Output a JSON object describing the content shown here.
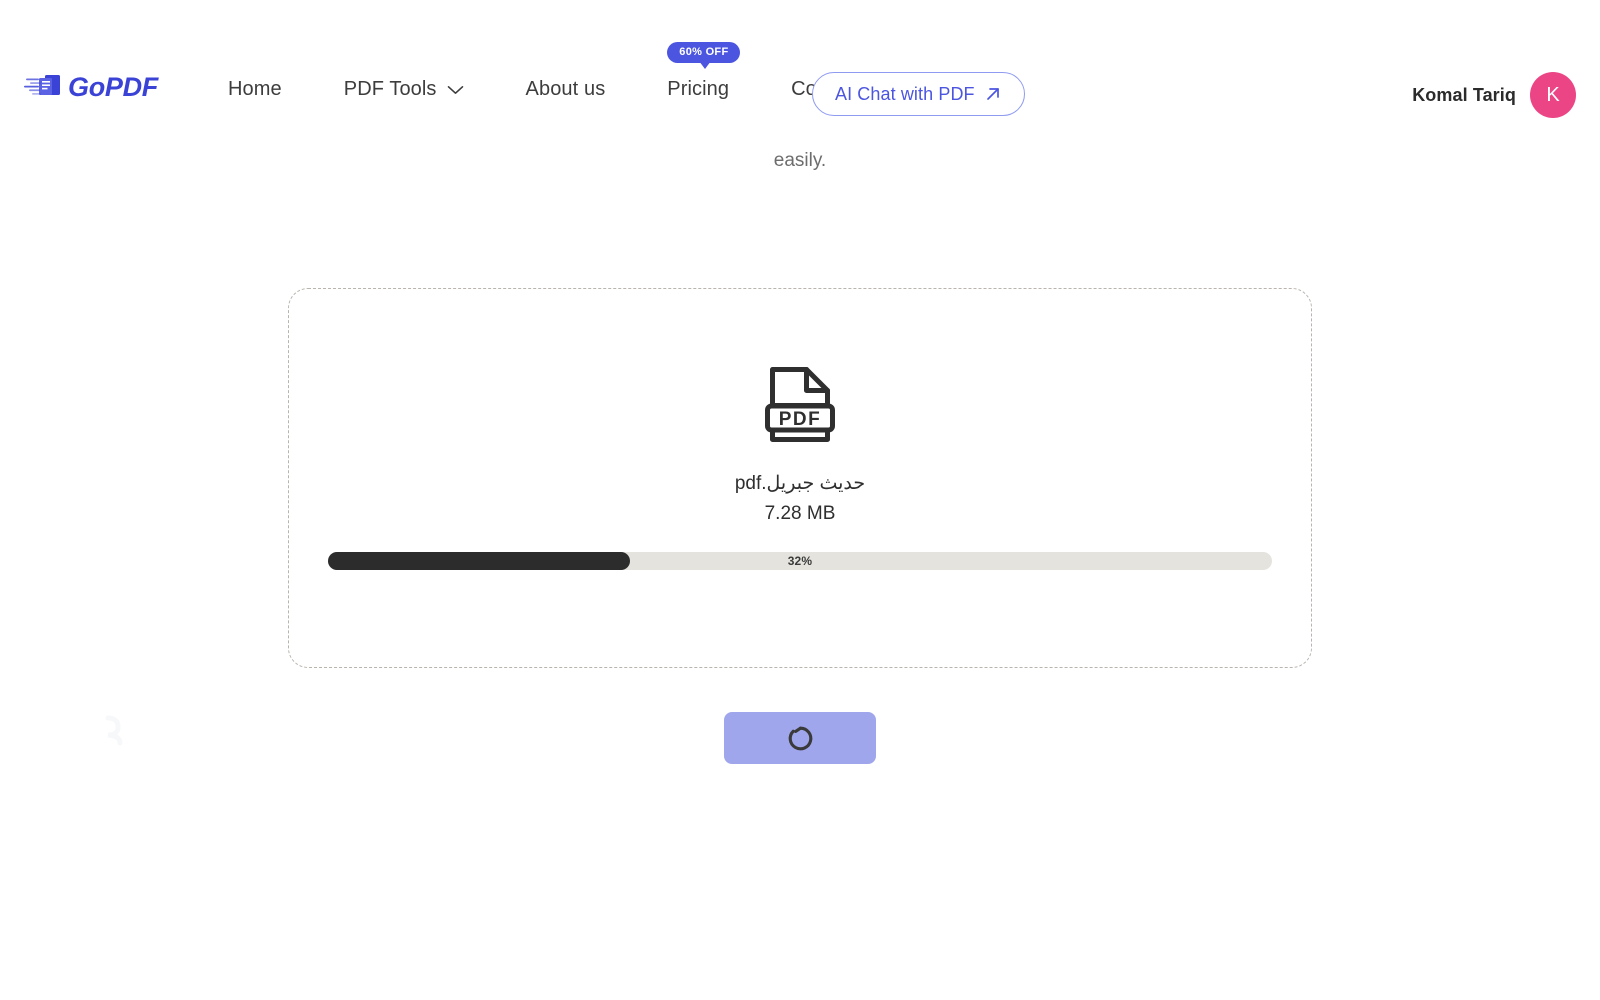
{
  "header": {
    "logo": {
      "name": "GoPDF",
      "icon": "gopdf-speed-document-icon",
      "color": "#3b43d6"
    },
    "nav": [
      {
        "label": "Home",
        "icon": null,
        "badge": null
      },
      {
        "label": "PDF Tools",
        "icon": "chevron-down-icon",
        "badge": null
      },
      {
        "label": "About us",
        "icon": null,
        "badge": null
      },
      {
        "label": "Pricing",
        "icon": null,
        "badge": "60% OFF"
      },
      {
        "label": "Contact us",
        "icon": null,
        "badge": null
      }
    ],
    "ai_chat": {
      "label": "AI Chat with PDF",
      "icon": "arrow-up-right-icon",
      "color": "#4b55e0"
    },
    "user": {
      "name": "Komal Tariq",
      "avatar_initial": "K",
      "avatar_color": "#ec4585"
    }
  },
  "intro": {
    "line_1": "",
    "line_2": "easily."
  },
  "upload": {
    "file_icon": "pdf-file-icon",
    "file_name": "حديث جبريل.pdf",
    "file_size": "7.28 MB",
    "progress_percent": 32,
    "progress_label": "32%",
    "progress_fill_color": "#2c2c2c",
    "progress_track_color": "#e4e3de"
  },
  "action": {
    "icon": "loading-spinner-icon",
    "label": "",
    "color": "#9fa6ec"
  }
}
